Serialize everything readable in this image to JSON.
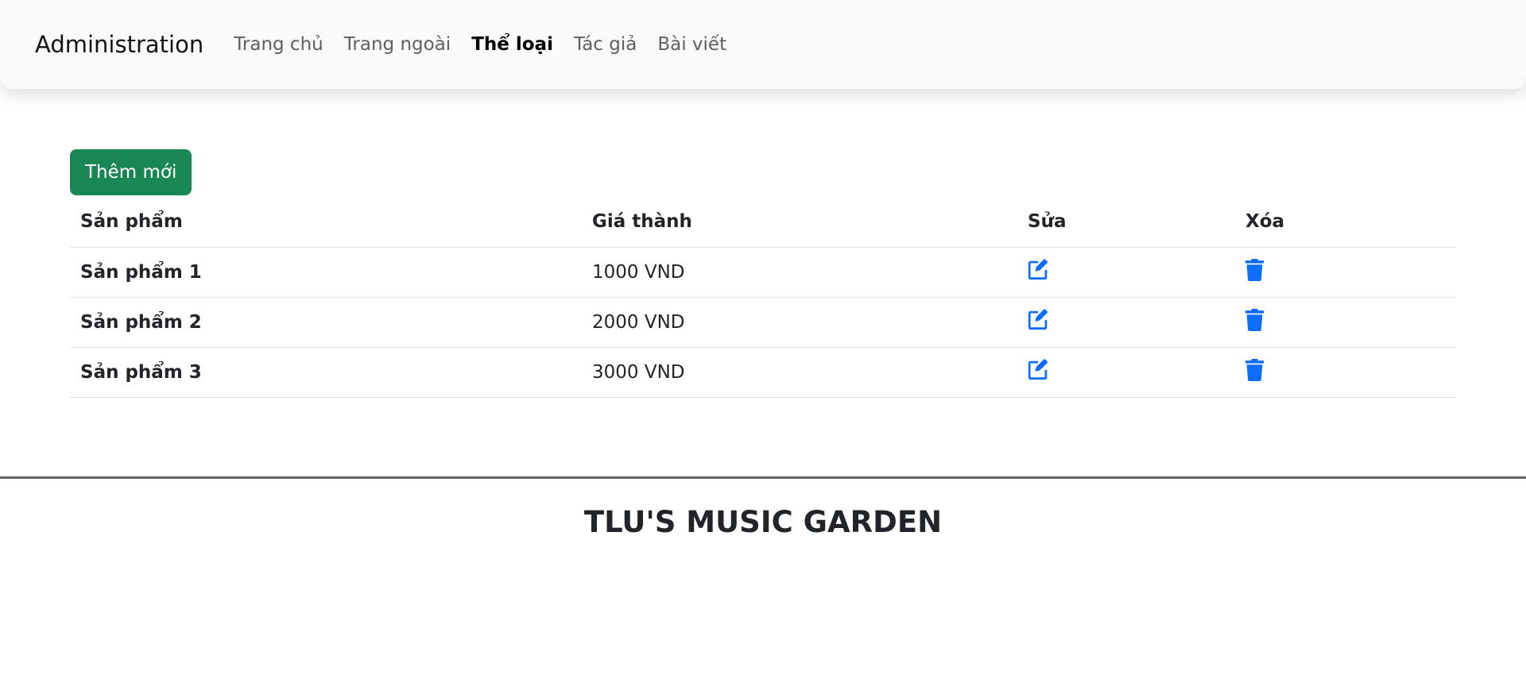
{
  "navbar": {
    "brand": "Administration",
    "links": [
      {
        "label": "Trang chủ"
      },
      {
        "label": "Trang ngoài"
      },
      {
        "label": "Thể loại"
      },
      {
        "label": "Tác giả"
      },
      {
        "label": "Bài viết"
      }
    ],
    "active": "Thể loại"
  },
  "main": {
    "add_button_label": "Thêm mới",
    "table": {
      "headers": [
        "Sản phẩm",
        "Giá thành",
        "Sửa",
        "Xóa"
      ],
      "rows": [
        {
          "product": "Sản phẩm 1",
          "price": "1000 VND",
          "edit_icon": "pencil-square-icon",
          "delete_icon": "trash-icon"
        },
        {
          "product": "Sản phẩm 2",
          "price": "2000 VND",
          "edit_icon": "pencil-square-icon",
          "delete_icon": "trash-icon"
        },
        {
          "product": "Sản phẩm 3",
          "price": "3000 VND",
          "edit_icon": "pencil-square-icon",
          "delete_icon": "trash-icon"
        }
      ]
    }
  },
  "footer": {
    "title": "TLU'S MUSIC GARDEN"
  },
  "colors": {
    "navbar_bg": "#f8f9fa",
    "success": "#198754",
    "icon_primary": "#0d6efd",
    "text": "#212529",
    "divider": "#5f666c"
  }
}
